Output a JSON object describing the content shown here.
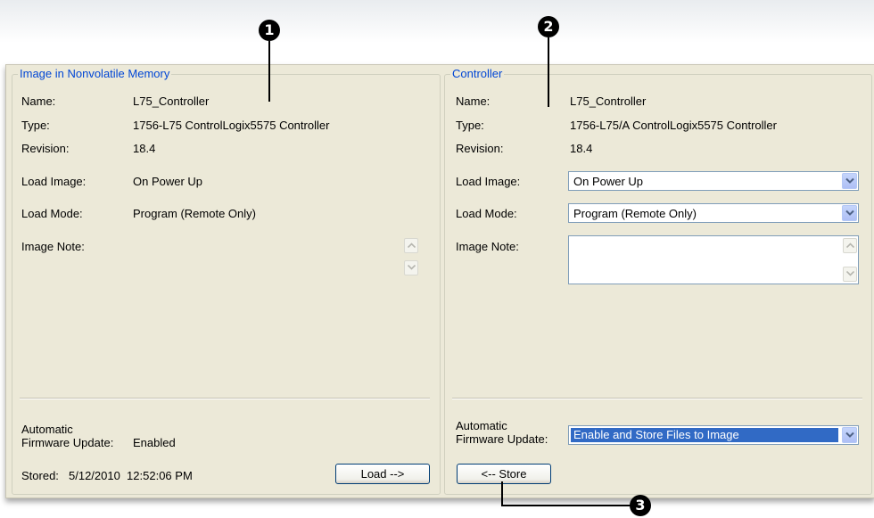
{
  "left": {
    "legend": "Image in Nonvolatile Memory",
    "name_label": "Name:",
    "name_value": "L75_Controller",
    "type_label": "Type:",
    "type_value": "1756-L75 ControlLogix5575 Controller",
    "revision_label": "Revision:",
    "revision_value": "18.4",
    "load_image_label": "Load Image:",
    "load_image_value": "On Power Up",
    "load_mode_label": "Load Mode:",
    "load_mode_value": "Program (Remote Only)",
    "image_note_label": "Image Note:",
    "afu_label_line1": "Automatic",
    "afu_label_line2": "Firmware Update:",
    "afu_value": "Enabled",
    "stored_label": "Stored:",
    "stored_value": "5/12/2010  12:52:06 PM",
    "load_button": "Load -->"
  },
  "right": {
    "legend": "Controller",
    "name_label": "Name:",
    "name_value": "L75_Controller",
    "type_label": "Type:",
    "type_value": "1756-L75/A ControlLogix5575 Controller",
    "revision_label": "Revision:",
    "revision_value": "18.4",
    "load_image_label": "Load Image:",
    "load_image_value": "On Power Up",
    "load_mode_label": "Load Mode:",
    "load_mode_value": "Program (Remote Only)",
    "image_note_label": "Image Note:",
    "afu_label_line1": "Automatic",
    "afu_label_line2": "Firmware Update:",
    "afu_value": "Enable and Store Files to Image",
    "store_button": "<-- Store"
  },
  "callouts": [
    "1",
    "2",
    "3"
  ],
  "colors": {
    "window_bg": "#ece9d8",
    "legend_text": "#0046d5",
    "selection": "#316ac5"
  }
}
